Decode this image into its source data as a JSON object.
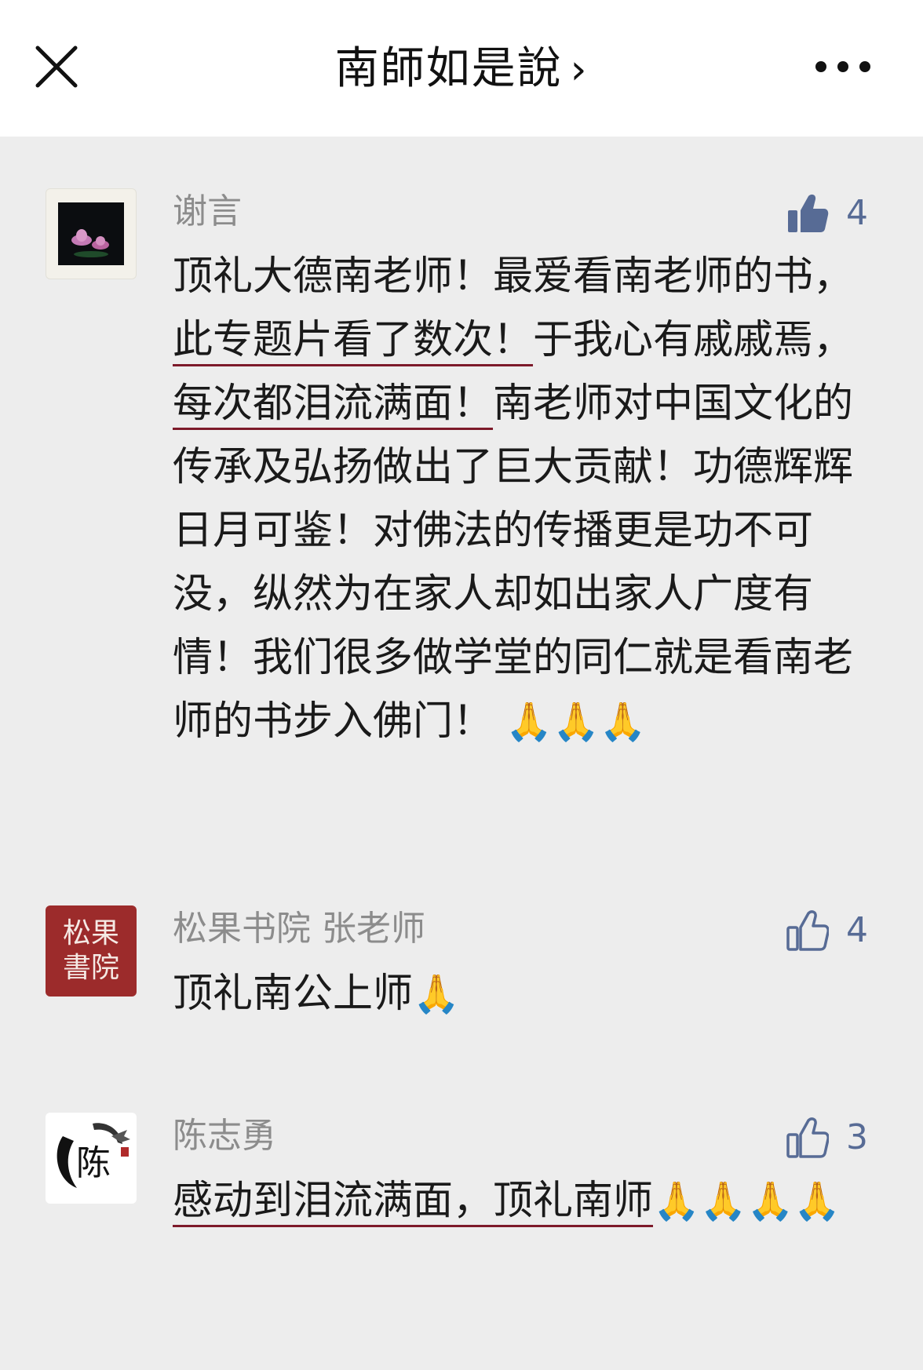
{
  "header": {
    "title": "南師如是說",
    "chevron": "›",
    "close_icon": "close-icon",
    "more_icon": "more-icon"
  },
  "comments": [
    {
      "author": "谢言",
      "likes": "4",
      "liked": true,
      "body": {
        "p1": "顶礼大德南老师！最爱看南老师的书，",
        "u1": "此专题片看了数次！",
        "p2": "于我心有戚戚焉，",
        "u2": "每次都泪流满面！",
        "p3": "南老师对中国文化的传承及弘扬做出了巨大贡献！功德辉辉日月可鉴！对佛法的传播更是功不可没，纵然为在家人却如出家人广度有情！我们很多做学堂的同仁就是看南老师的书步入佛门！",
        "emoji": "🙏🙏🙏"
      }
    },
    {
      "author": "松果书院 张老师",
      "avatar_text": "松果書院",
      "likes": "4",
      "liked": false,
      "body": {
        "p1": "顶礼南公上师",
        "emoji": "🙏"
      }
    },
    {
      "author": "陈志勇",
      "avatar_text": "陈",
      "likes": "3",
      "liked": false,
      "body": {
        "u1": "感动到泪流满面，顶礼南师",
        "emoji": "🙏🙏🙏🙏"
      }
    }
  ],
  "colors": {
    "background": "#ededed",
    "bar": "#ffffff",
    "link_blue": "#576b95",
    "underline": "#7d1a2a",
    "seal_red": "#9c2b2b"
  }
}
